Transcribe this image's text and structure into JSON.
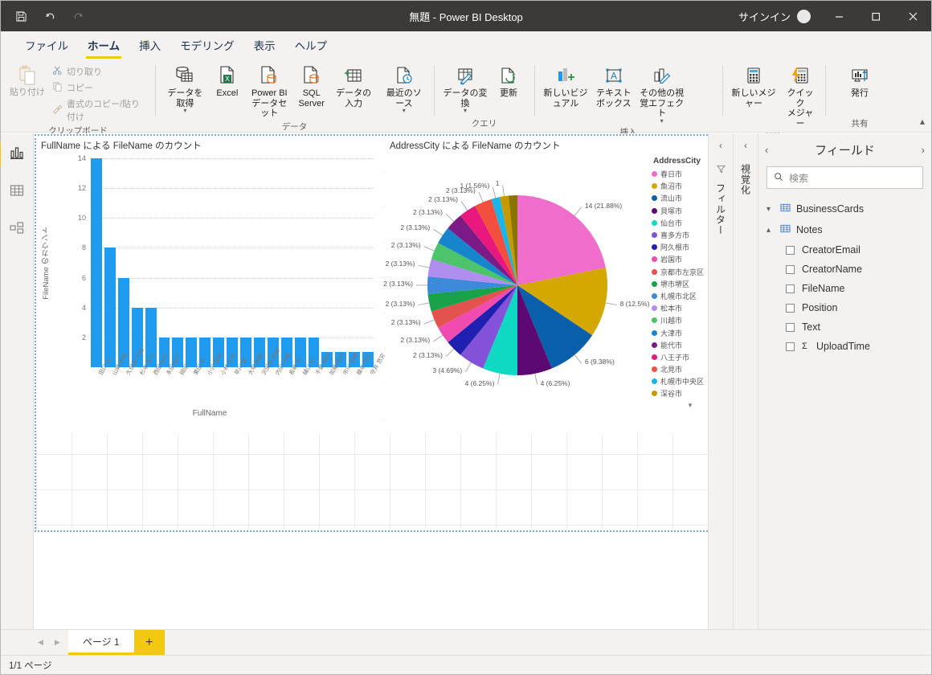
{
  "window": {
    "title": "無題 - Power BI Desktop",
    "signin_label": "サインイン",
    "quick_access": [
      "save-icon",
      "undo-icon",
      "redo-icon"
    ],
    "controls": {
      "minimize": "—",
      "maximize": "☐",
      "close": "✕"
    }
  },
  "menu": {
    "tabs": [
      {
        "label": "ファイル",
        "active": false
      },
      {
        "label": "ホーム",
        "active": true
      },
      {
        "label": "挿入",
        "active": false
      },
      {
        "label": "モデリング",
        "active": false
      },
      {
        "label": "表示",
        "active": false
      },
      {
        "label": "ヘルプ",
        "active": false
      }
    ]
  },
  "ribbon": {
    "groups": [
      {
        "name": "クリップボード",
        "paste_label": "貼り付け",
        "items": [
          {
            "label": "切り取り",
            "icon": "scissors-icon"
          },
          {
            "label": "コピー",
            "icon": "copy-icon"
          },
          {
            "label": "書式のコピー/貼り付け",
            "icon": "format-painter-icon"
          }
        ]
      },
      {
        "name": "データ",
        "items": [
          {
            "label": "データを取得",
            "icon": "get-data-icon",
            "caret": true
          },
          {
            "label": "Excel",
            "icon": "excel-icon",
            "caret": false
          },
          {
            "label": "Power BI\nデータセット",
            "icon": "powerbi-dataset-icon",
            "caret": false
          },
          {
            "label": "SQL\nServer",
            "icon": "sql-server-icon",
            "caret": false
          },
          {
            "label": "データの入力",
            "icon": "enter-data-icon",
            "caret": false
          },
          {
            "label": "最近のソース",
            "icon": "recent-sources-icon",
            "caret": true
          }
        ]
      },
      {
        "name": "クエリ",
        "items": [
          {
            "label": "データの変換",
            "icon": "transform-data-icon",
            "caret": true
          },
          {
            "label": "更新",
            "icon": "refresh-icon",
            "caret": false
          }
        ]
      },
      {
        "name": "挿入",
        "items": [
          {
            "label": "新しいビジュアル",
            "icon": "new-visual-icon",
            "caret": false
          },
          {
            "label": "テキスト\nボックス",
            "icon": "text-box-icon",
            "caret": false
          },
          {
            "label": "その他の視覚エフェクト",
            "icon": "more-visuals-icon",
            "caret": true
          }
        ]
      },
      {
        "name": "計算",
        "items": [
          {
            "label": "新しいメジャー",
            "icon": "new-measure-icon",
            "caret": false
          },
          {
            "label": "クイック\nメジャー",
            "icon": "quick-measure-icon",
            "caret": false
          }
        ]
      },
      {
        "name": "共有",
        "items": [
          {
            "label": "発行",
            "icon": "publish-icon",
            "caret": false
          }
        ]
      }
    ],
    "collapse_icon": "chevron-up-icon"
  },
  "viewbar": {
    "items": [
      {
        "name": "report-view",
        "icon": "bar-chart-icon",
        "active": true
      },
      {
        "name": "data-view",
        "icon": "table-icon",
        "active": false
      },
      {
        "name": "model-view",
        "icon": "model-icon",
        "active": false
      }
    ]
  },
  "panes": {
    "filters": {
      "label": "フィルター",
      "icon": "funnel-icon",
      "collapse_icon": "chevron-left-icon"
    },
    "visualizations": {
      "label": "視覚化",
      "collapse_icon": "chevron-left-icon"
    },
    "fields": {
      "title": "フィールド",
      "collapse_left_icon": "chevron-left-icon",
      "expand_right_icon": "chevron-right-icon",
      "search_placeholder": "検索",
      "search_icon": "search-icon",
      "tables": [
        {
          "name": "BusinessCards",
          "expanded": false,
          "chevron": "chevron-down-icon",
          "fields": []
        },
        {
          "name": "Notes",
          "expanded": true,
          "chevron": "chevron-up-icon",
          "fields": [
            {
              "name": "CreatorEmail",
              "checked": false,
              "aggregate": false
            },
            {
              "name": "CreatorName",
              "checked": false,
              "aggregate": false
            },
            {
              "name": "FileName",
              "checked": false,
              "aggregate": false
            },
            {
              "name": "Position",
              "checked": false,
              "aggregate": false
            },
            {
              "name": "Text",
              "checked": false,
              "aggregate": false
            },
            {
              "name": "UploadTime",
              "checked": false,
              "aggregate": true
            }
          ]
        }
      ]
    }
  },
  "bottom": {
    "page_tab": "ページ 1",
    "add_page_icon": "plus-icon",
    "prev_icon": "triangle-left-icon",
    "next_icon": "triangle-right-icon",
    "status": "1/1 ページ"
  },
  "chart_data": [
    {
      "type": "bar",
      "title": "FullName による FileName のカウント",
      "xlabel": "FullName",
      "ylabel": "FileName のカウント",
      "ylim": [
        0,
        14
      ],
      "yticks": [
        14,
        12,
        10,
        8,
        6,
        4,
        2
      ],
      "grid": true,
      "color": "#1f9cf0",
      "categories": [
        "田口 花",
        "山崎 麻希",
        "久保田 大樹",
        "杉本 紘也",
        "西田 聡乎",
        "永田 勝子",
        "岡田",
        "栗田 学",
        "小沢 貴裕",
        "小林 志保",
        "早川 健",
        "大塚 輝雄",
        "沢田田 智雄",
        "内田 沙織",
        "長嶋 治",
        "樋口 拓",
        "千葉 章枝",
        "加藤 紘也",
        "市川 瑞穂",
        "榎本 弥生",
        "守井 悠究"
      ],
      "values": [
        14,
        8,
        6,
        4,
        4,
        2,
        2,
        2,
        2,
        2,
        2,
        2,
        2,
        2,
        2,
        2,
        2,
        1,
        1,
        1,
        1
      ]
    },
    {
      "type": "pie",
      "title": "AddressCity による FileName のカウント",
      "legend_title": "AddressCity",
      "legend_position": "right",
      "total": 64,
      "slices": [
        {
          "label": "春日市",
          "value": 14,
          "percent": "21.88%",
          "data_label": "14 (21.88%)",
          "color": "#ef6ecb"
        },
        {
          "label": "魚沼市",
          "value": 8,
          "percent": "12.5%",
          "data_label": "8 (12.5%)",
          "color": "#d4a800"
        },
        {
          "label": "流山市",
          "value": 6,
          "percent": "9.38%",
          "data_label": "6 (9.38%)",
          "color": "#0a5faa"
        },
        {
          "label": "貝塚市",
          "value": 4,
          "percent": "6.25%",
          "data_label": "4 (6.25%)",
          "color": "#5c0a73"
        },
        {
          "label": "仙台市",
          "value": 4,
          "percent": "6.25%",
          "data_label": "4 (6.25%)",
          "color": "#0fd9c2"
        },
        {
          "label": "喜多方市",
          "value": 3,
          "percent": "4.69%",
          "data_label": "3 (4.69%)",
          "color": "#8352d8"
        },
        {
          "label": "阿久根市",
          "value": 2,
          "percent": "3.13%",
          "data_label": "2 (3.13%)",
          "color": "#2020b0"
        },
        {
          "label": "岩国市",
          "value": 2,
          "percent": "3.13%",
          "data_label": "2 (3.13%)",
          "color": "#ef4bb0"
        },
        {
          "label": "京都市左京区",
          "value": 2,
          "percent": "3.13%",
          "data_label": "2 (3.13%)",
          "color": "#e3524e"
        },
        {
          "label": "堺市堺区",
          "value": 2,
          "percent": "3.13%",
          "data_label": "2 (3.13%)",
          "color": "#18a24a"
        },
        {
          "label": "札幌市北区",
          "value": 2,
          "percent": "3.13%",
          "data_label": "2 (3.13%)",
          "color": "#3d8bd8"
        },
        {
          "label": "松本市",
          "value": 2,
          "percent": "3.13%",
          "data_label": "2 (3.13%)",
          "color": "#b08ef0"
        },
        {
          "label": "川越市",
          "value": 2,
          "percent": "3.13%",
          "data_label": "2 (3.13%)",
          "color": "#4bc46b"
        },
        {
          "label": "大津市",
          "value": 2,
          "percent": "3.13%",
          "data_label": "2 (3.13%)",
          "color": "#1785cc"
        },
        {
          "label": "能代市",
          "value": 2,
          "percent": "3.13%",
          "data_label": "2 (3.13%)",
          "color": "#7d1b86"
        },
        {
          "label": "八王子市",
          "value": 2,
          "percent": "3.13%",
          "data_label": "2 (3.13%)",
          "color": "#e8187f"
        },
        {
          "label": "北見市",
          "value": 2,
          "percent": "3.13%",
          "data_label": "2 (3.13%)",
          "color": "#f24f3e"
        },
        {
          "label": "札幌市中央区",
          "value": 1,
          "percent": "1.56%",
          "data_label": "1 (1.56%)",
          "color": "#19b4e8"
        },
        {
          "label": "深谷市",
          "value": 1,
          "percent": "1.56%",
          "data_label": "1",
          "color": "#c49a00"
        },
        {
          "label": "",
          "value": 1,
          "percent": "1.56%",
          "data_label": "",
          "color": "#8a7300"
        }
      ],
      "legend_more_icon": "chevron-down-icon"
    }
  ]
}
